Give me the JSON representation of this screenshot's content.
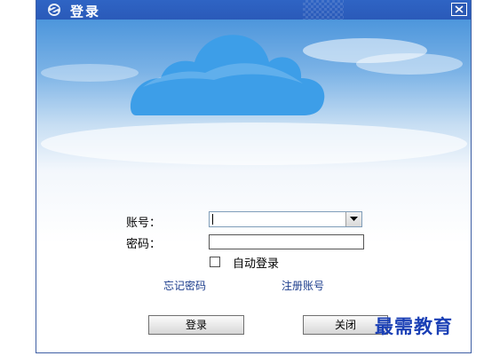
{
  "window": {
    "title": "登录",
    "close_glyph": "✕"
  },
  "colors": {
    "titlebar": "#2f64c4",
    "cloud": "#3d9ee8",
    "link": "#1c3d8c",
    "watermark": "#1a3fb5"
  },
  "icons": {
    "app": "app-logo-icon",
    "close": "close-icon",
    "dropdown": "chevron-down-icon"
  },
  "form": {
    "account_label": "账号：",
    "account_value": "",
    "password_label": "密码：",
    "password_value": "",
    "auto_login_label": "自动登录",
    "auto_login_checked": false
  },
  "links": {
    "forgot_password": "忘记密码",
    "register_account": "注册账号"
  },
  "buttons": {
    "login": "登录",
    "close": "关闭"
  },
  "watermark": "最需教育"
}
